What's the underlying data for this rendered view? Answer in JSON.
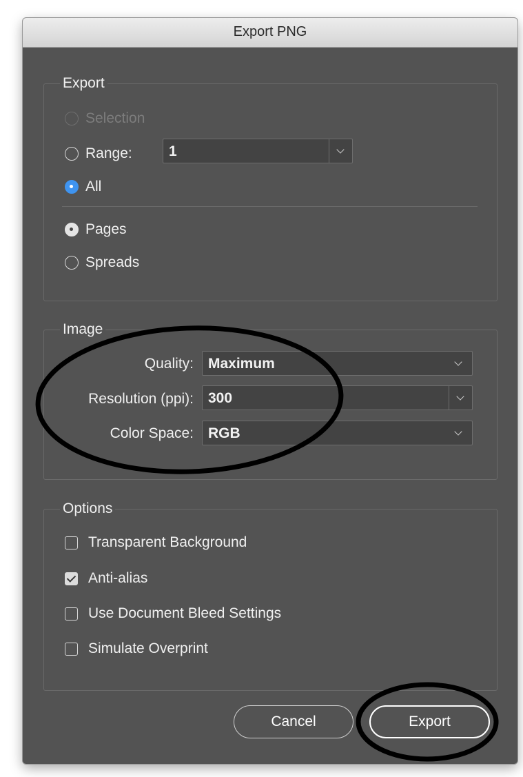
{
  "dialog": {
    "title": "Export PNG"
  },
  "export_group": {
    "legend": "Export",
    "selection_label": "Selection",
    "range_label": "Range:",
    "range_value": "1",
    "all_label": "All",
    "pages_label": "Pages",
    "spreads_label": "Spreads",
    "selected_scope": "All",
    "selected_layout": "Pages"
  },
  "image_group": {
    "legend": "Image",
    "quality_label": "Quality:",
    "quality_value": "Maximum",
    "resolution_label": "Resolution (ppi):",
    "resolution_value": "300",
    "color_space_label": "Color Space:",
    "color_space_value": "RGB"
  },
  "options_group": {
    "legend": "Options",
    "transparent_label": "Transparent Background",
    "transparent_checked": false,
    "antialias_label": "Anti-alias",
    "antialias_checked": true,
    "bleed_label": "Use Document Bleed Settings",
    "bleed_checked": false,
    "overprint_label": "Simulate Overprint",
    "overprint_checked": false
  },
  "buttons": {
    "cancel": "Cancel",
    "export": "Export"
  },
  "colors": {
    "dialog_bg": "#535353",
    "radio_accent": "#3f94f0",
    "annotation": "#000000"
  },
  "icons": [
    "chevron-down-icon",
    "checkmark-icon"
  ]
}
